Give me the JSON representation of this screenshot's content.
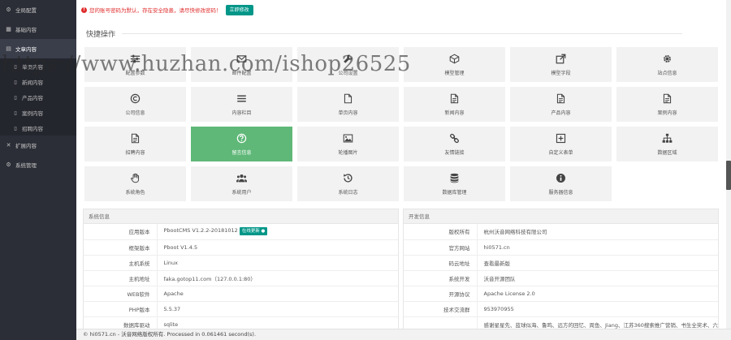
{
  "sidebar": {
    "items": [
      {
        "label": "全局配置",
        "icon": "gear-icon",
        "glyph": "⚙"
      },
      {
        "label": "基础内容",
        "icon": "grid-icon",
        "glyph": "▦"
      },
      {
        "label": "文章内容",
        "icon": "file-icon",
        "glyph": "▤"
      }
    ],
    "subitems": [
      {
        "label": "单页内容",
        "glyph": "▯"
      },
      {
        "label": "新闻内容",
        "glyph": "▯"
      },
      {
        "label": "产品内容",
        "glyph": "▯"
      },
      {
        "label": "案例内容",
        "glyph": "▯"
      },
      {
        "label": "招聘内容",
        "glyph": "▯"
      }
    ],
    "bottom": [
      {
        "label": "扩展内容",
        "icon": "expand-icon",
        "glyph": "✕"
      },
      {
        "label": "系统管理",
        "icon": "gear-icon",
        "glyph": "⚙"
      }
    ]
  },
  "alert": {
    "message": "您的账号密码为默认，存在安全隐患，请尽快修改密码！",
    "button": "立即修改"
  },
  "quick": {
    "title": "快捷操作",
    "items": [
      {
        "label": "配置参数",
        "icon": "sliders"
      },
      {
        "label": "邮件配置",
        "icon": "mail"
      },
      {
        "label": "公司设置",
        "icon": "wrench"
      },
      {
        "label": "模型管理",
        "icon": "cube"
      },
      {
        "label": "模型字段",
        "icon": "external"
      },
      {
        "label": "站点信息",
        "icon": "cog"
      },
      {
        "label": "公司信息",
        "icon": "copyright"
      },
      {
        "label": "内容栏目",
        "icon": "bars"
      },
      {
        "label": "单页内容",
        "icon": "doc"
      },
      {
        "label": "新闻内容",
        "icon": "doc-text"
      },
      {
        "label": "产品内容",
        "icon": "doc-text"
      },
      {
        "label": "案例内容",
        "icon": "doc-text"
      },
      {
        "label": "招聘内容",
        "icon": "doc-text"
      },
      {
        "label": "留言信息",
        "icon": "question"
      },
      {
        "label": "轮播图片",
        "icon": "image"
      },
      {
        "label": "友情链接",
        "icon": "link"
      },
      {
        "label": "自定义表单",
        "icon": "plus-square"
      },
      {
        "label": "数据区域",
        "icon": "sitemap"
      },
      {
        "label": "系统角色",
        "icon": "hand"
      },
      {
        "label": "系统用户",
        "icon": "users"
      },
      {
        "label": "系统日志",
        "icon": "history"
      },
      {
        "label": "数据库管理",
        "icon": "database"
      },
      {
        "label": "服务器信息",
        "icon": "info"
      }
    ]
  },
  "system_info": {
    "title": "系统信息",
    "rows": [
      {
        "k": "应用版本",
        "v": "PbootCMS V1.2.2-20181012",
        "tag": "在线更新 ●"
      },
      {
        "k": "框架版本",
        "v": "Pboot V1.4.5"
      },
      {
        "k": "主机系统",
        "v": "Linux"
      },
      {
        "k": "主机地址",
        "v": "faka.gotop11.com（127.0.0.1:80）"
      },
      {
        "k": "WEB软件",
        "v": "Apache"
      },
      {
        "k": "PHP版本",
        "v": "5.5.37"
      },
      {
        "k": "数据库驱动",
        "v": "sqlite"
      }
    ]
  },
  "dev_info": {
    "title": "开发信息",
    "rows": [
      {
        "k": "版权所有",
        "v": "杭州沃音网络科技有限公司"
      },
      {
        "k": "官方网站",
        "v": "hi0571.cn"
      },
      {
        "k": "码云地址",
        "v": "查看最新版"
      },
      {
        "k": "系统开发",
        "v": "沃音开源团队"
      },
      {
        "k": "开源协议",
        "v": "Apache License 2.0"
      },
      {
        "k": "技术交流群",
        "v": "953970955"
      },
      {
        "k": "",
        "v": "感谢星星先、蓝球似海、鲁鸣、远方的回忆、周鱼、Jiang、江苏360搜索推广营销、书生全奖术、六"
      }
    ]
  },
  "footer": {
    "text": "© hi0571.cn - 沃音网络版权所有. Processed in 0.061461 second(s)."
  },
  "watermark": {
    "text": "https://www.huzhan.com/ishop26525"
  },
  "colors": {
    "sidebar_bg": "#2b2e37",
    "accent": "#009688",
    "highlight_card": "#5fb878",
    "alert_red": "#e02c2c"
  }
}
